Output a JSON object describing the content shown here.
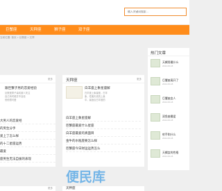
{
  "search": {
    "placeholder": "输入关键词搜索..."
  },
  "nav": [
    {
      "label": "巨蟹座"
    },
    {
      "label": "天秤座"
    },
    {
      "label": "狮子座"
    },
    {
      "label": "双子座"
    }
  ],
  "breadcrumb": "当前位置: 首页 > 巨蟹座 > 文章",
  "left_panel": {
    "more": "更多",
    "feature_title": "跟巨蟹子男的恋爱经验",
    "feature_summary": [
      "巨蟹座男子喜欢被人关注",
      "自己有时候并不自信",
      "但他很可爱"
    ],
    "list": [
      "大男人的恋爱经",
      "的男生分手",
      "爱上了怎么样",
      "的十二星座运势",
      "最爱",
      "座男生无法自拔的表现"
    ]
  },
  "mid_panel": {
    "title": "天秤座",
    "more": "更多",
    "feature_title": "白羊座上象星座解",
    "feature_summary": [
      "白羊座上象星座，白羊",
      "象，性格天真的上象",
      "中，最适合白羊座的"
    ],
    "list": [
      "白羊座上象星座解",
      "巨蟹座最爱什么星座",
      "白羊座最爱的真面目",
      "金牛的水瓶座要怎么样",
      "巨蟹座今日财运运势怎么"
    ]
  },
  "bottom_left": {
    "more": "更多"
  },
  "bottom_mid": {
    "title": "天秤座"
  },
  "hot": {
    "title": "热门文章",
    "items": [
      {
        "text": "天蝎男最什么",
        "date": "2022-06-18"
      },
      {
        "text": "巨蟹座离开了",
        "date": "2022-06-18"
      },
      {
        "text": "巨蟹座女人",
        "date": "2022-06-18"
      },
      {
        "text": "双鱼座最爱",
        "date": "2022-06-18"
      },
      {
        "text": "射手和什么",
        "date": "2022-06-18"
      },
      {
        "text": "天蝎女的性格",
        "date": "2022-06-18"
      }
    ]
  },
  "watermark": "便民库"
}
